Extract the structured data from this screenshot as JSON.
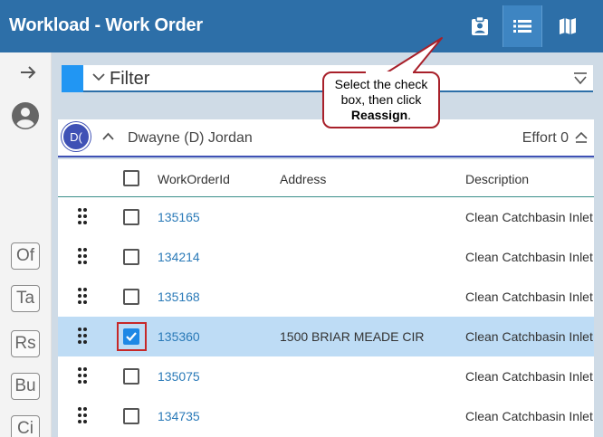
{
  "header": {
    "title": "Workload - Work Order",
    "buttons": [
      {
        "icon": "assignment-ind-icon"
      },
      {
        "icon": "list-icon",
        "active": true
      },
      {
        "icon": "map-icon"
      }
    ]
  },
  "rail": {
    "chips": [
      "Of",
      "Ta",
      "Rs",
      "Bu",
      "Ci"
    ]
  },
  "filter": {
    "label": "Filter",
    "swatch_color": "#2196f3"
  },
  "group": {
    "initials": "D(",
    "name": "Dwayne (D) Jordan",
    "effort": "Effort 0"
  },
  "table": {
    "columns": [
      "WorkOrderId",
      "Address",
      "Description"
    ],
    "rows": [
      {
        "id": "135165",
        "address": "",
        "description": "Clean Catchbasin Inlet",
        "checked": false,
        "selected": false
      },
      {
        "id": "134214",
        "address": "",
        "description": "Clean Catchbasin Inlet",
        "checked": false,
        "selected": false
      },
      {
        "id": "135168",
        "address": "",
        "description": "Clean Catchbasin Inlet",
        "checked": false,
        "selected": false
      },
      {
        "id": "135360",
        "address": "1500 BRIAR MEADE CIR",
        "description": "Clean Catchbasin Inlet",
        "checked": true,
        "selected": true
      },
      {
        "id": "135075",
        "address": "",
        "description": "Clean Catchbasin Inlet",
        "checked": false,
        "selected": false
      },
      {
        "id": "134735",
        "address": "",
        "description": "Clean Catchbasin Inlet",
        "checked": false,
        "selected": false
      }
    ]
  },
  "callout": {
    "line1": "Select the check",
    "line2": "box, then click",
    "bold": "Reassign",
    "suffix": "."
  },
  "colors": {
    "header": "#2d6fa8",
    "selected_row": "#bedcf5",
    "link": "#2a7ab8",
    "callout_border": "#a8202a"
  }
}
